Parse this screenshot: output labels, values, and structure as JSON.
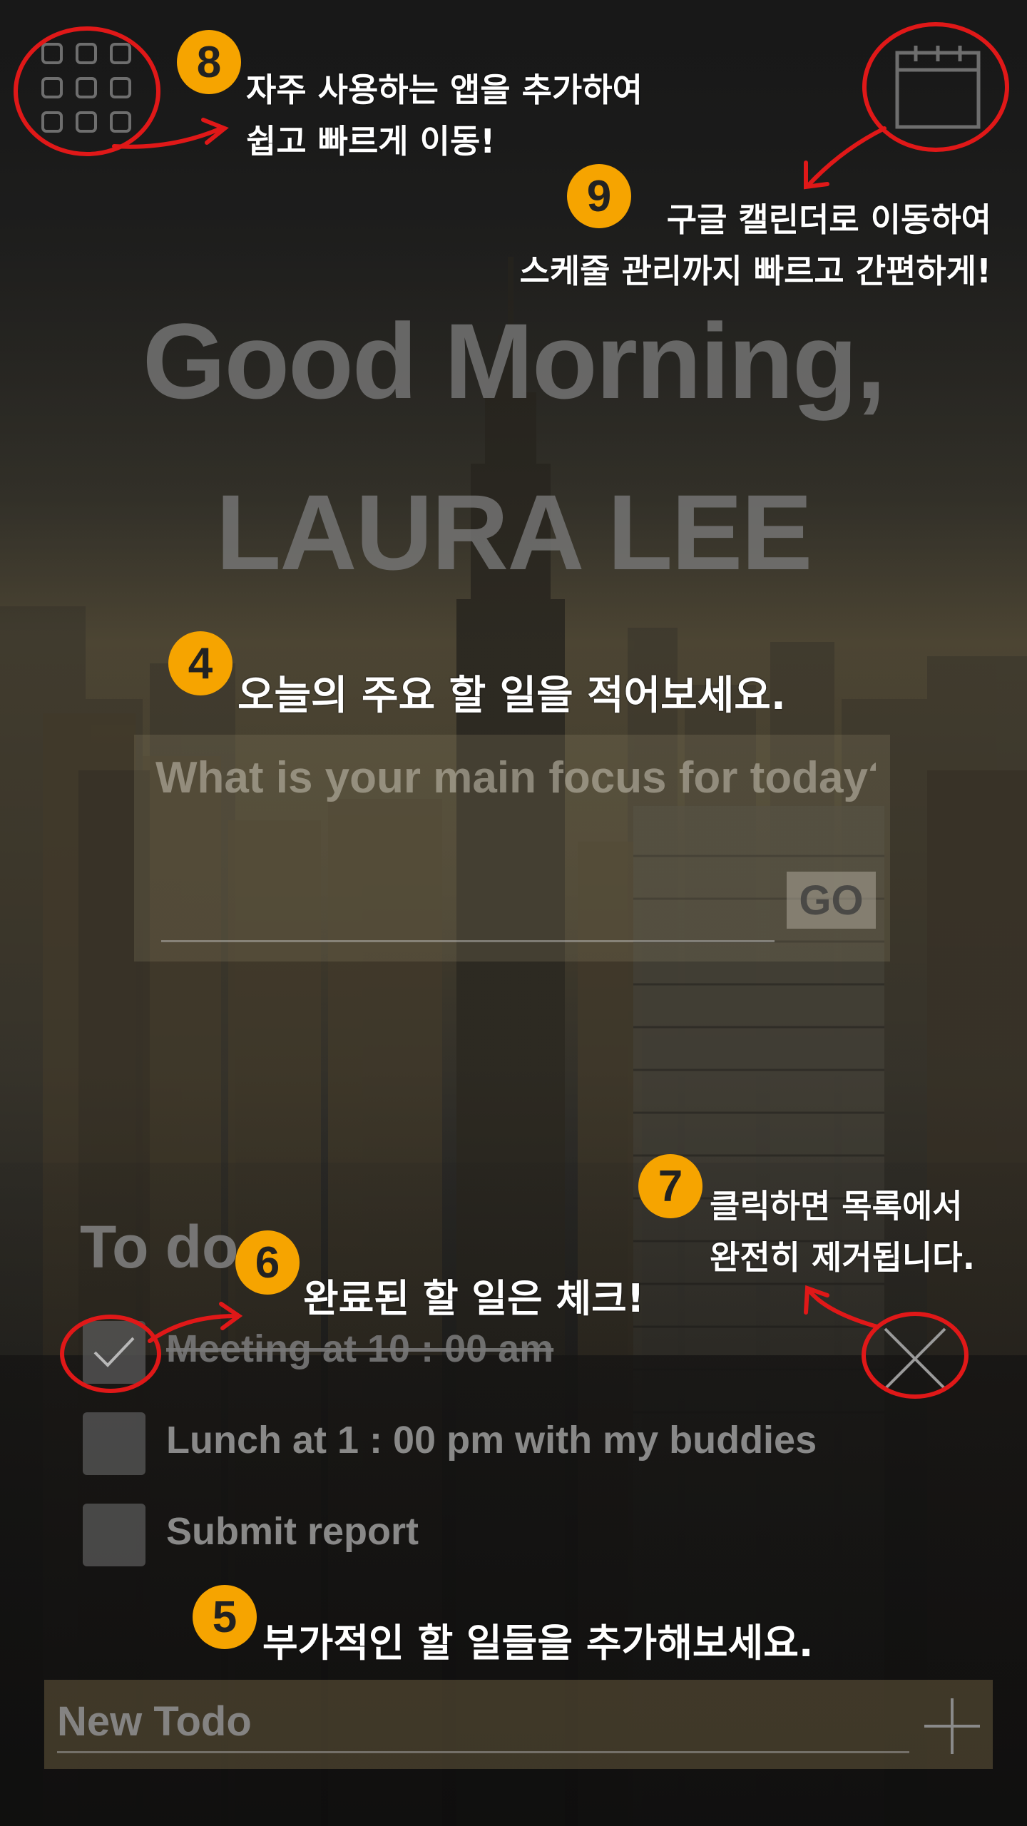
{
  "greeting": {
    "line1": "Good Morning,",
    "line2": "LAURA LEE"
  },
  "focus": {
    "placeholder": "What is your main focus for today?",
    "go_label": "GO"
  },
  "todo": {
    "title": "To do",
    "items": [
      {
        "text": "Meeting at 10 : 00 am",
        "done": true
      },
      {
        "text": "Lunch at 1 : 00 pm with my buddies",
        "done": false
      },
      {
        "text": "Submit report",
        "done": false
      }
    ]
  },
  "new_todo": {
    "placeholder": "New Todo"
  },
  "icons": {
    "apps": "grid-icon",
    "calendar": "calendar-icon",
    "check": "check-icon",
    "delete": "close-icon",
    "add": "plus-icon"
  },
  "callouts": {
    "c8": {
      "number": "8",
      "line1": "자주 사용하는 앱을 추가하여",
      "line2": "쉽고 빠르게 이동!"
    },
    "c9": {
      "number": "9",
      "line1": "구글 캘린더로 이동하여",
      "line2": "스케줄 관리까지 빠르고 간편하게!"
    },
    "c4": {
      "number": "4",
      "line1": "오늘의 주요 할 일을 적어보세요."
    },
    "c6": {
      "number": "6",
      "line1": "완료된 할 일은 체크!"
    },
    "c7": {
      "number": "7",
      "line1": "클릭하면 목록에서",
      "line2": "완전히 제거됩니다."
    },
    "c5": {
      "number": "5",
      "line1": "부가적인 할 일들을 추가해보세요."
    }
  },
  "colors": {
    "badge": "#f6a400",
    "annotation_red": "#e01818"
  }
}
